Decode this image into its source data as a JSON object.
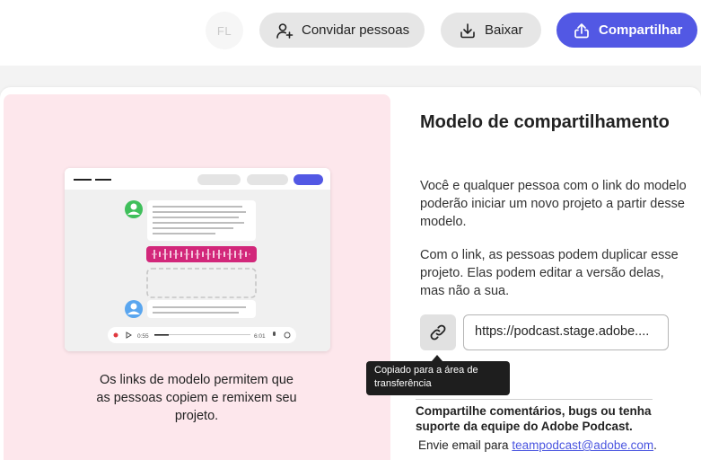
{
  "header": {
    "avatar_initials": "FL",
    "invite_label": "Convidar pessoas",
    "download_label": "Baixar",
    "share_label": "Compartilhar",
    "accent_color": "#5258e4"
  },
  "illustration": {
    "player_time_start": "0:55",
    "player_time_end": "6:01",
    "caption": "Os links de modelo permitem que as pessoas copiem e remixem seu projeto."
  },
  "share_panel": {
    "title": "Modelo de compartilhamento",
    "description_1": "Você e qualquer pessoa com o link do modelo poderão iniciar um novo projeto a partir desse modelo.",
    "description_2": "Com o link, as pessoas podem duplicar esse projeto. Elas podem editar a versão delas, mas não a sua.",
    "link_value": "https://podcast.stage.adobe....",
    "copy_icon": "link-icon",
    "tooltip": "Copiado para a área de transferência"
  },
  "feedback": {
    "title": "Compartilhe comentários, bugs ou tenha suporte da equipe do Adobe Podcast.",
    "email_prefix": "Envie email para ",
    "email": "teampodcast@adobe.com",
    "email_suffix": "."
  }
}
